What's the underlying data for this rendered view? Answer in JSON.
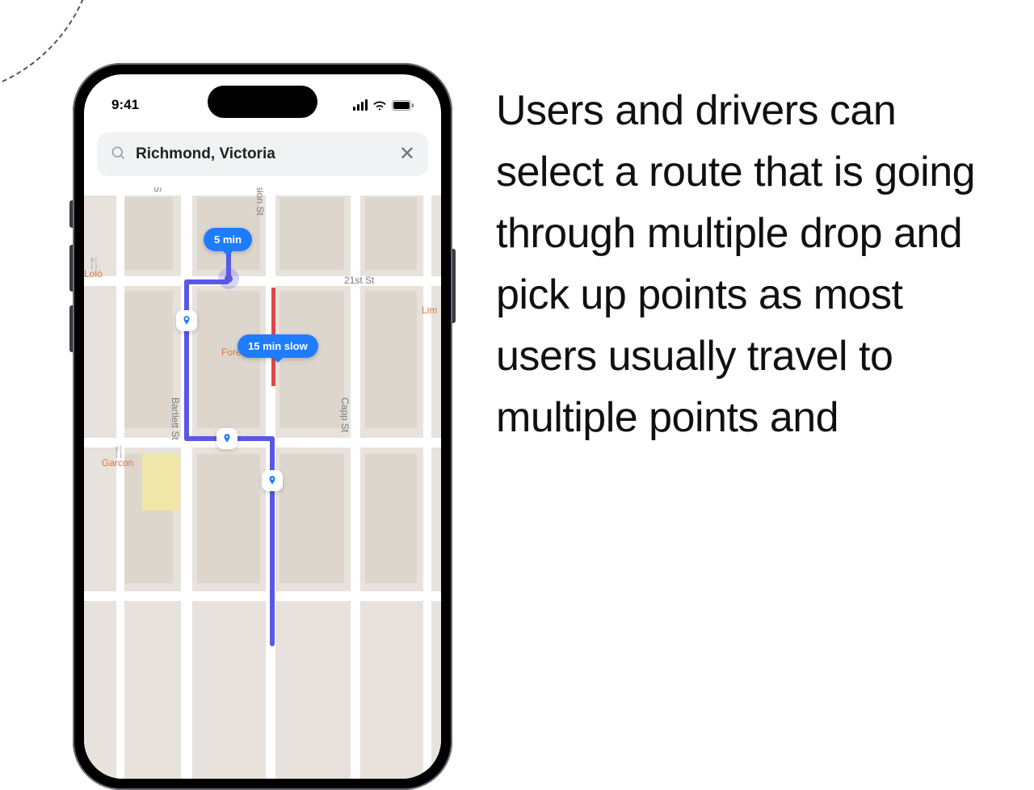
{
  "status": {
    "time": "9:41"
  },
  "search": {
    "value": "Richmond, Victoria"
  },
  "map": {
    "streets": {
      "s": "S",
      "sion": "sion St",
      "twentyfirst": "21st St",
      "capp": "Capp St",
      "bartlett": "Bartlett St"
    },
    "poi": {
      "lolo": "Loló",
      "garcon": "Garcon",
      "fore": "Fore",
      "lim": "Lim"
    },
    "bubbles": {
      "fast": "5 min",
      "slow": "15 min slow"
    }
  },
  "description": "Users and drivers can select a route that is going through multiple drop and pick up points as most users usually travel to multiple points and"
}
